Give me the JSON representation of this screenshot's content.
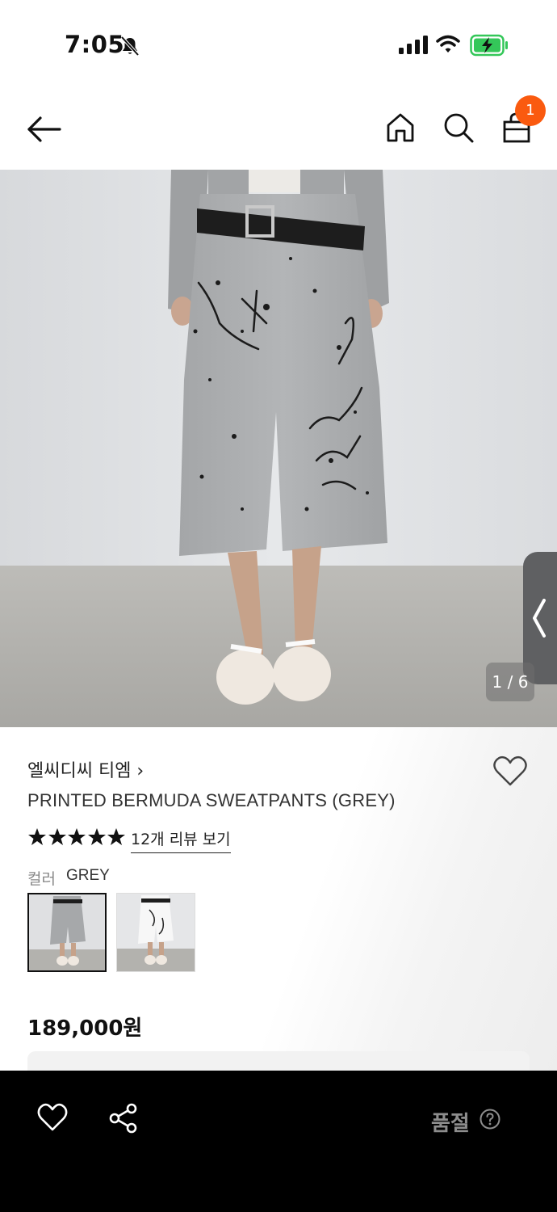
{
  "status_bar": {
    "time": "7:05",
    "icons": [
      "bell-slash-icon",
      "signal-icon",
      "wifi-icon",
      "battery-charging-icon"
    ]
  },
  "nav": {
    "icons": [
      "back-arrow-icon",
      "home-icon",
      "search-icon",
      "shopping-bag-icon"
    ],
    "cart_count": "1"
  },
  "gallery": {
    "counter": "1 / 6"
  },
  "product": {
    "brand": "엘씨디씨 티엠 ›",
    "name": "PRINTED BERMUDA SWEATPANTS (GREY)",
    "rating": 5,
    "review_link": "12개 리뷰 보기",
    "color_label": "컬러",
    "color_value": "GREY",
    "swatches": [
      "grey",
      "white"
    ],
    "price": "189,000원"
  },
  "bottom_bar": {
    "status_label": "품절",
    "icons": [
      "heart-outline-icon",
      "share-icon",
      "help-circle-icon"
    ]
  },
  "colors": {
    "badge": "#fa5a0f",
    "battery": "#34c759",
    "bottom_bar": "#000000",
    "soldout_text": "#8d8d8d"
  }
}
